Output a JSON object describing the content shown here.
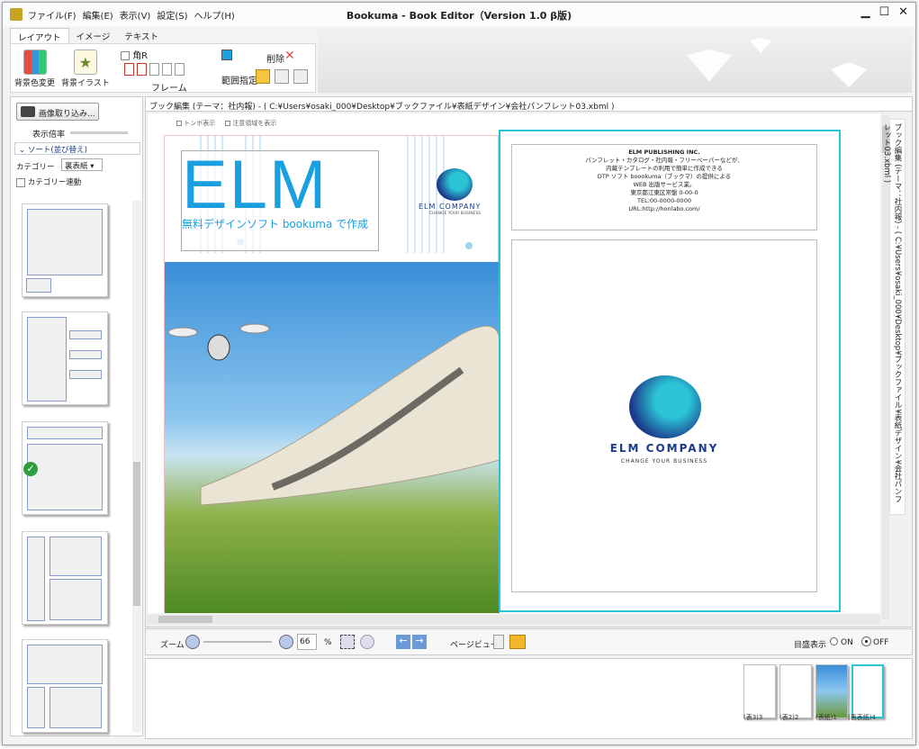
{
  "window": {
    "title": "Bookuma - Book Editor（Version 1.0 β版)"
  },
  "menu": [
    "ファイル(F)",
    "編集(E)",
    "表示(V)",
    "設定(S)",
    "ヘルプ(H)"
  ],
  "tabs": [
    "レイアウト",
    "イメージ",
    "テキスト"
  ],
  "ribbon": {
    "bg_color": "背景色変更",
    "bg_illust": "背景イラスト",
    "kakuR": "角R",
    "frame": "フレーム",
    "delete": "削除",
    "range": "範囲指定"
  },
  "sidebar": {
    "import": "画像取り込み...",
    "zoom_label": "表示倍率",
    "sort": "ソート(並び替え)",
    "category_label": "カテゴリー",
    "category_value": "裏表紙",
    "category_link": "カテゴリー連動"
  },
  "editor": {
    "header": "ブック編集 (テーマ：社内報) - ( C:¥Users¥osaki_000¥Desktop¥ブックファイル¥表紙デザイン¥会社パンフレット03.xbml )",
    "tombo": "トンボ表示",
    "note": "注意領域を表示",
    "spine": "ブック編集 (テーマ：社内報) - ( C:¥Users¥osaki_000¥Desktop¥ブックファイル¥表紙デザイン¥会社パンフレット03.xbml )"
  },
  "cover": {
    "elm": "ELM",
    "tagline": "無料デザインソフト bookuma で作成",
    "logo_name": "ELM COMPANY",
    "logo_sub": "CHANGE YOUR BUSINESS"
  },
  "info": {
    "lines": [
      "ELM PUBLISHING INC.",
      "パンフレット・カタログ・社内報・フリーペーパーなどが、",
      "内蔵テンプレートの利用で簡単に作成できる",
      "DTP ソフト boookuma（ブックマ）の提供による",
      "WEB 出版サービス業。",
      "東京都江東区常盤 0-00-0",
      "TEL:00-0000-0000",
      "URL:http://honlabo.com/"
    ]
  },
  "back": {
    "logo_name": "ELM COMPANY",
    "logo_sub": "CHANGE YOUR BUSINESS"
  },
  "zoom": {
    "label": "ズーム",
    "value": "66",
    "unit": "%",
    "page_view": "ページビュー",
    "ruler": "目盛表示",
    "on": "ON",
    "off": "OFF"
  },
  "tray": {
    "labels": [
      "(表3)3",
      "(表2)2",
      "(表紙)1",
      "(裏表紙)4"
    ]
  },
  "colors": {
    "accent": "#1a9fe0",
    "teal": "#2bc4d6",
    "navy": "#1b3a8a"
  }
}
